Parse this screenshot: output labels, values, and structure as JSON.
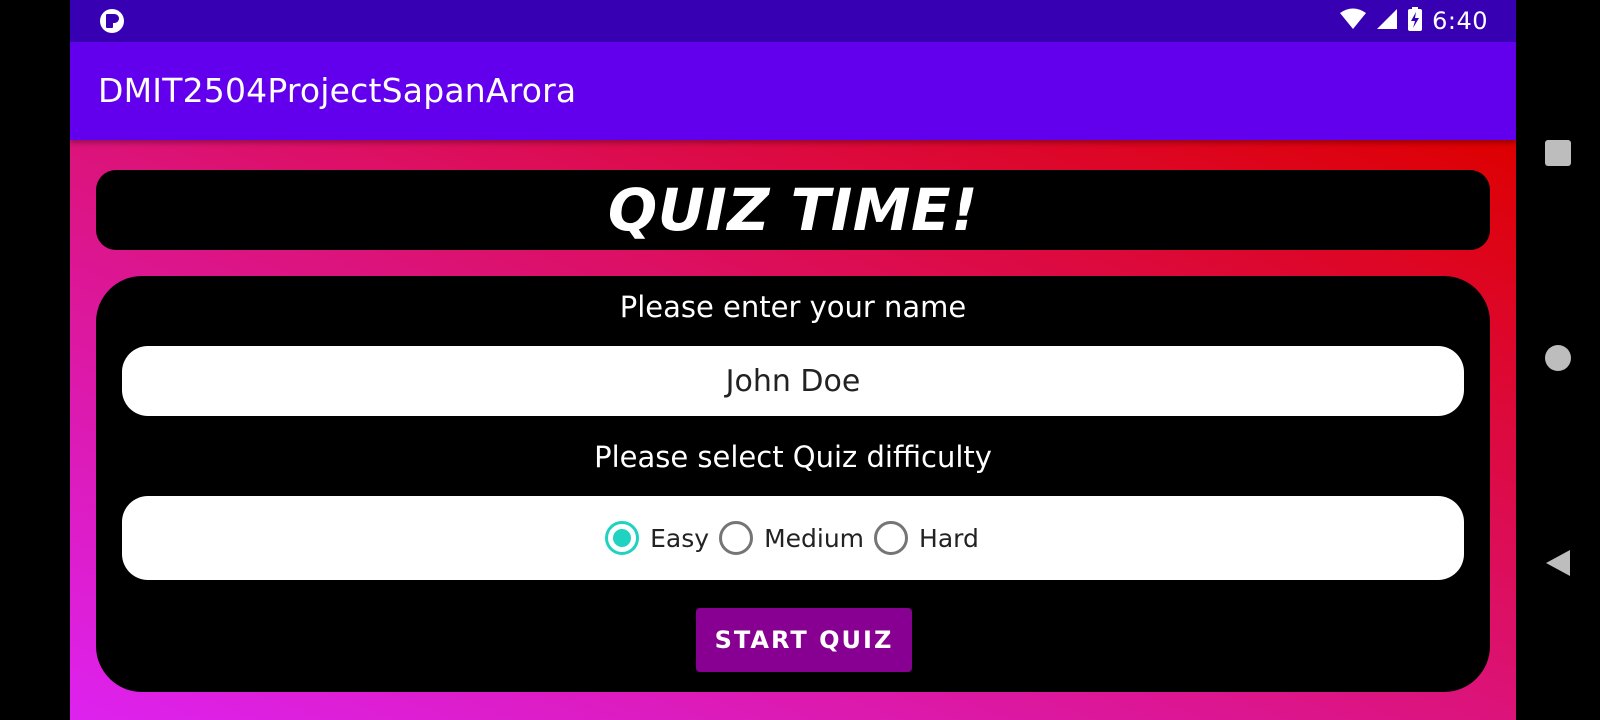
{
  "status_bar": {
    "time": "6:40",
    "icons": [
      "app-notification-icon",
      "wifi-icon",
      "cell-signal-icon",
      "battery-charging-icon"
    ]
  },
  "app_bar": {
    "title": "DMIT2504ProjectSapanArora"
  },
  "main": {
    "heading": "QUIZ TIME!",
    "name_prompt": "Please enter your name",
    "name_value": "John Doe",
    "difficulty_prompt": "Please select Quiz difficulty",
    "difficulty_options": [
      {
        "label": "Easy",
        "selected": true
      },
      {
        "label": "Medium",
        "selected": false
      },
      {
        "label": "Hard",
        "selected": false
      }
    ],
    "start_button_label": "START QUIZ"
  },
  "nav_bar": {
    "icons": [
      "recents-icon",
      "home-icon",
      "back-icon"
    ]
  },
  "colors": {
    "status_bar": "#3700B3",
    "app_bar": "#6200EE",
    "gradient_start": "#DD22F0",
    "gradient_end": "#DD0000",
    "radio_accent": "#1FD3C0",
    "start_button": "#880091"
  }
}
